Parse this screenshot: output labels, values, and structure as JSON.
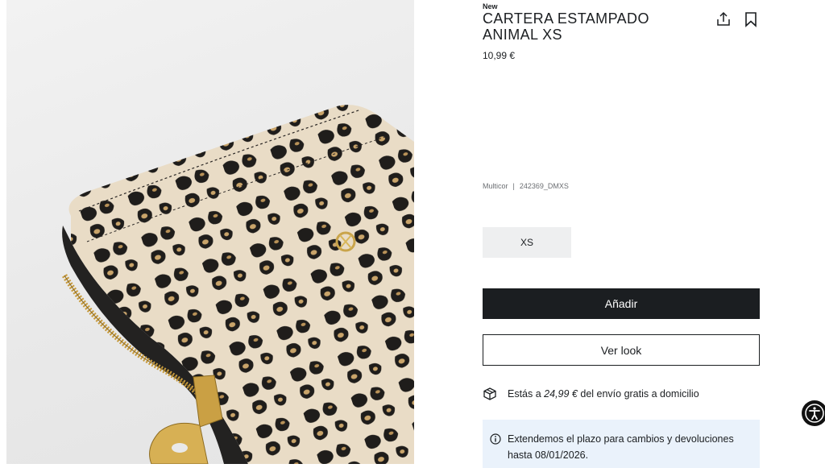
{
  "product": {
    "badge": "New",
    "title": "CARTERA ESTAMPADO ANIMAL XS",
    "price": "10,99 €",
    "color": "Multicor",
    "sku": "242369_DMXS"
  },
  "size": {
    "selected": "XS"
  },
  "actions": {
    "add_label": "Añadir",
    "look_label": "Ver look"
  },
  "shipping": {
    "prefix": "Estás a ",
    "amount": "24,99 €",
    "suffix": " del envío gratis a domicilio"
  },
  "notice": {
    "text": "Extendemos el plazo para cambios y devoluciones hasta 08/01/2026."
  },
  "icons": {
    "share": "share-icon",
    "bookmark": "bookmark-icon",
    "shipping": "package-icon",
    "info": "info-icon",
    "accessibility": "accessibility-icon"
  },
  "colors": {
    "primary": "#1b1e21",
    "notice_bg": "#eaf2fb",
    "chip_bg": "#eeeff0"
  }
}
